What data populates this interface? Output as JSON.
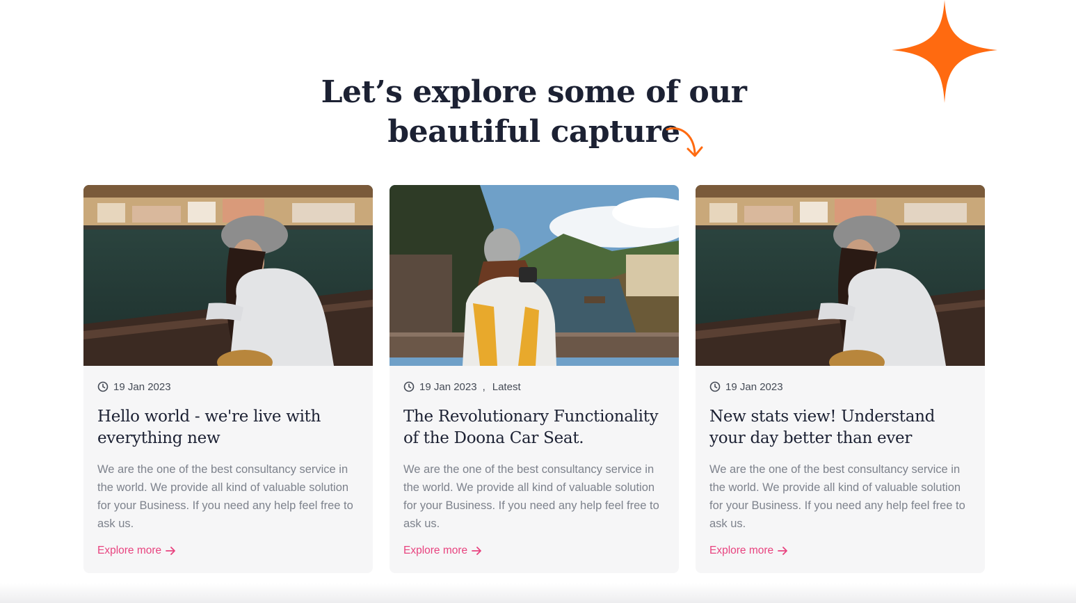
{
  "section": {
    "heading_line1": "Let’s explore some of our",
    "heading_line2": "beautiful capture"
  },
  "colors": {
    "accent_orange": "#ff6a10",
    "link_pink": "#e8437f",
    "heading_navy": "#1c2133",
    "card_bg": "#f6f6f7"
  },
  "icons": {
    "sparkle": "four-point-star-icon",
    "curve_arrow": "curved-arrow-down-icon",
    "clock": "clock-icon",
    "arrow": "arrow-right-icon"
  },
  "cards": [
    {
      "image": "woman-in-beret-by-lake-photo",
      "date": "19 Jan 2023",
      "category": "",
      "title": "Hello world - we're live with everything new",
      "text": "We are the one of the best consultancy service in the world. We provide all kind of valuable solution for your Business. If you need any help feel free to ask us.",
      "link": "Explore more"
    },
    {
      "image": "woman-photographing-river-photo",
      "date": "19 Jan 2023",
      "separator": ",",
      "category": "Latest",
      "title": "The Revolutionary Functionality of the Doona Car Seat.",
      "text": "We are the one of the best consultancy service in the world. We provide all kind of valuable solution for your Business. If you need any help feel free to ask us.",
      "link": "Explore more"
    },
    {
      "image": "woman-in-beret-by-lake-photo",
      "date": "19 Jan 2023",
      "category": "",
      "title": "New stats view! Understand your day better than ever",
      "text": "We are the one of the best consultancy service in the world. We provide all kind of valuable solution for your Business. If you need any help feel free to ask us.",
      "link": "Explore more"
    }
  ]
}
